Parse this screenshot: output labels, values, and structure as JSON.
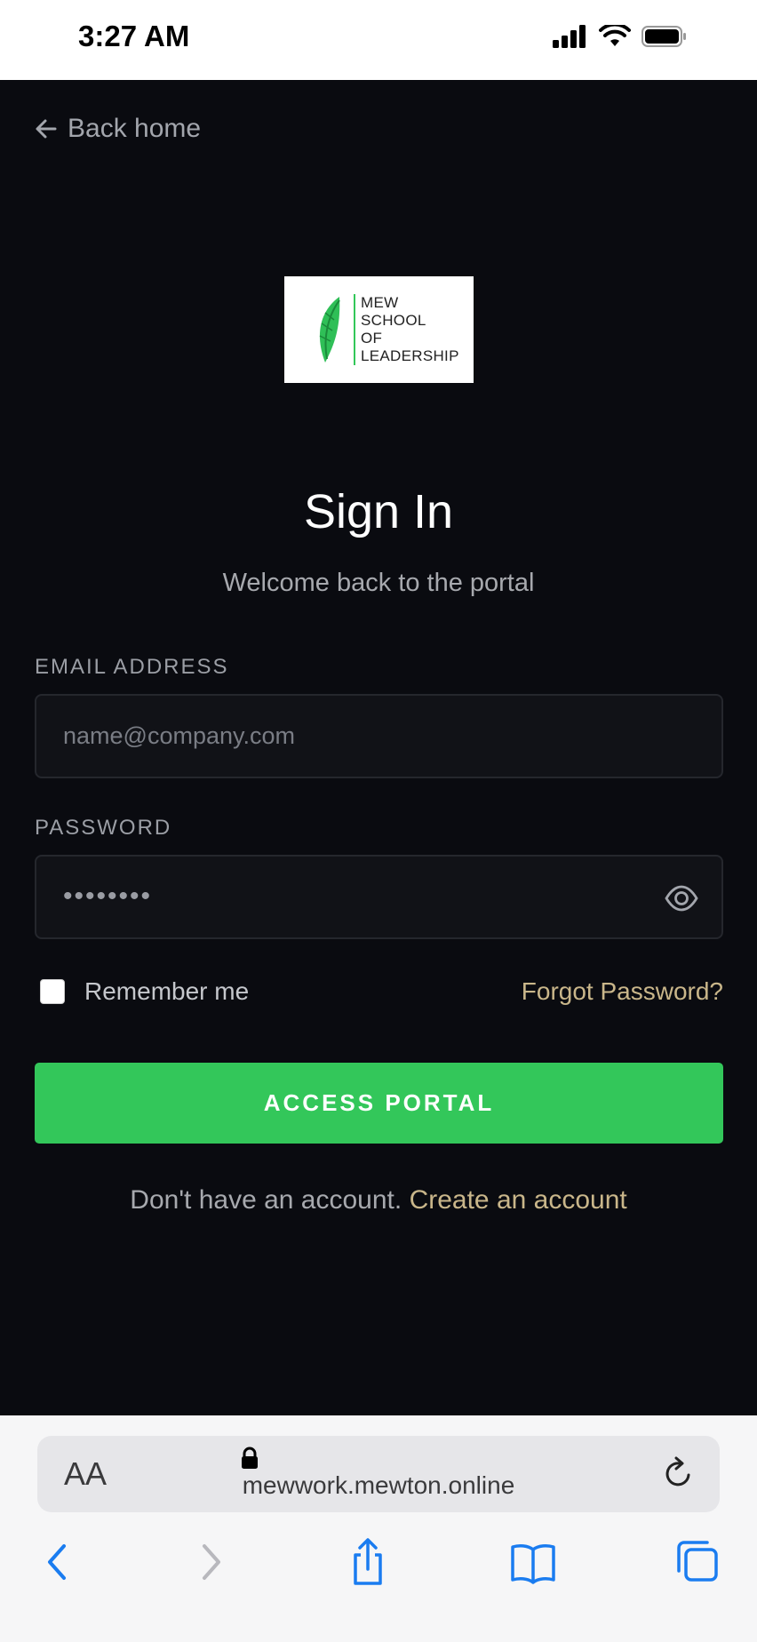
{
  "status_bar": {
    "time": "3:27 AM"
  },
  "page": {
    "back_link": "Back home",
    "logo_text": "MEW\nSCHOOL\nOF\nLEADERSHIP",
    "title": "Sign In",
    "subtitle": "Welcome back to the portal",
    "email": {
      "label": "EMAIL ADDRESS",
      "placeholder": "name@company.com",
      "value": ""
    },
    "password": {
      "label": "PASSWORD",
      "masked_value": "••••••••"
    },
    "remember_label": "Remember me",
    "remember_checked": false,
    "forgot_link": "Forgot Password?",
    "submit_label": "ACCESS PORTAL",
    "signup_text": "Don't have an account.",
    "signup_link": "Create an account"
  },
  "browser": {
    "text_size_label": "AA",
    "url": "mewwork.mewton.online"
  },
  "colors": {
    "background": "#0a0b10",
    "accent_green": "#33c75a",
    "link_gold": "#c9b68a",
    "input_bg": "#111217"
  }
}
